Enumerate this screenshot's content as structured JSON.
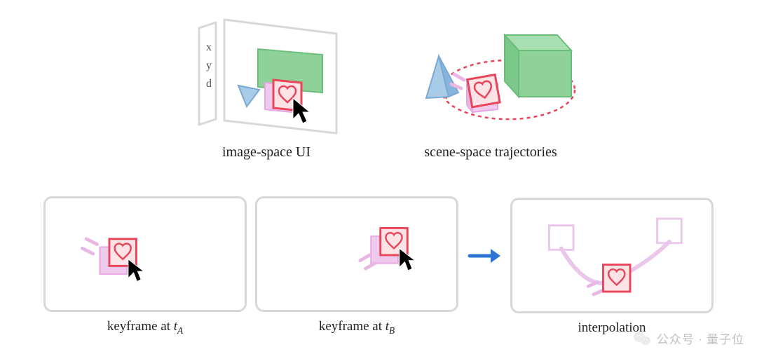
{
  "top": {
    "left_label": "image-space UI",
    "right_label": "scene-space trajectories",
    "axis_labels": [
      "x",
      "y",
      "d"
    ]
  },
  "bottom": {
    "keyframe_a": {
      "label_prefix": "keyframe at ",
      "var": "t",
      "sub": "A"
    },
    "keyframe_b": {
      "label_prefix": "keyframe at ",
      "var": "t",
      "sub": "B"
    },
    "interp_label": "interpolation"
  },
  "watermark": {
    "text": "公众号 · 量子位"
  },
  "colors": {
    "frame": "#d8d8d8",
    "green_fill": "#8ed29a",
    "green_stroke": "#6bbd7a",
    "blue_fill": "#a8cbe8",
    "blue_stroke": "#7aa9d1",
    "pink_fill": "#f0caed",
    "pink_stroke": "#e6a7e2",
    "red": "#e8455a",
    "red_dark": "#d13a4e",
    "violet_light": "#e9c6ea",
    "arrow_blue": "#2e74d6"
  }
}
